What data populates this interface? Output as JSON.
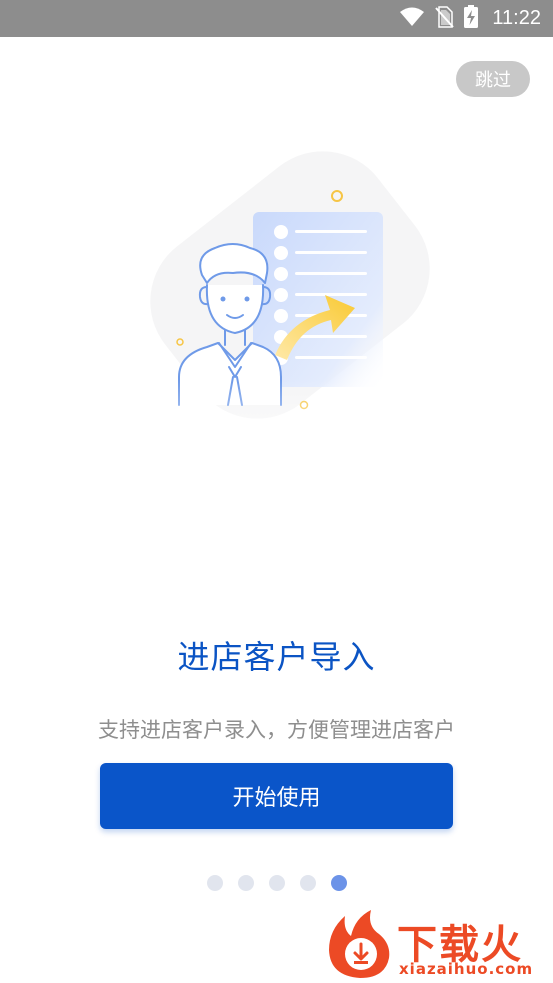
{
  "status_bar": {
    "time": "11:22",
    "icons": [
      "wifi-icon",
      "no-sim-icon",
      "battery-charging-icon"
    ]
  },
  "skip_button": {
    "label": "跳过"
  },
  "illustration": {
    "icon": "customer-import-illustration"
  },
  "content": {
    "title": "进店客户导入",
    "subtitle": "支持进店客户录入，方便管理进店客户"
  },
  "start_button": {
    "label": "开始使用"
  },
  "pager": {
    "count": 5,
    "active_index": 4
  },
  "watermark": {
    "text": "下载火",
    "sub": "xiazaihuo.com"
  },
  "colors": {
    "status_bar": "#8d8d8d",
    "accent": "#0a55c9",
    "title": "#0b54c4",
    "subtitle": "#8e8e8e",
    "dot_inactive": "#e1e5ee",
    "dot_active": "#6c93e8",
    "watermark": "#ec4a25"
  }
}
